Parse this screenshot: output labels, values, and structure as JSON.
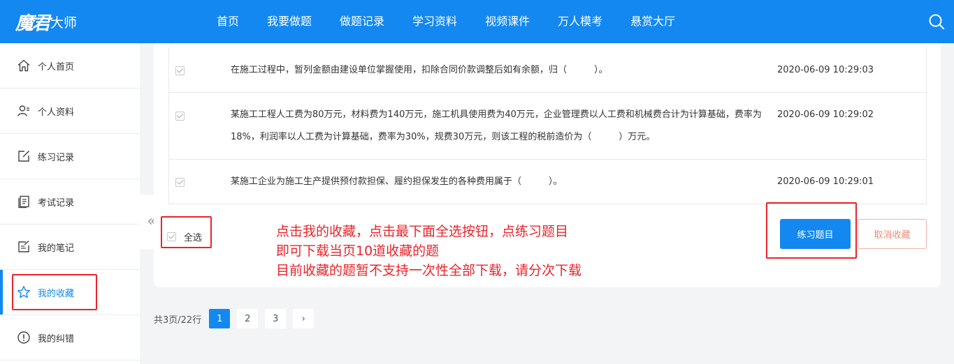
{
  "header": {
    "logo_brush": "魔君",
    "logo_text": "大师",
    "nav": [
      "首页",
      "我要做题",
      "做题记录",
      "学习资料",
      "视频课件",
      "万人模考",
      "悬赏大厅"
    ],
    "search_icon": "search-icon"
  },
  "sidebar": {
    "items": [
      {
        "label": "个人首页",
        "icon": "home-icon"
      },
      {
        "label": "个人资料",
        "icon": "user-profile-icon"
      },
      {
        "label": "练习记录",
        "icon": "edit-square-icon"
      },
      {
        "label": "考试记录",
        "icon": "document-icon"
      },
      {
        "label": "我的笔记",
        "icon": "note-icon"
      },
      {
        "label": "我的收藏",
        "icon": "star-icon",
        "active": true
      },
      {
        "label": "我的纠错",
        "icon": "alert-circle-icon"
      }
    ]
  },
  "collapse": {
    "glyph": "«"
  },
  "questions": [
    {
      "text": "在施工过程中，暂列金额由建设单位掌握使用，扣除合同价款调整后如有余额，归（　　　）。",
      "time": "2020-06-09 10:29:03",
      "checked": true
    },
    {
      "text": "某施工工程人工费为80万元，材料费为140万元，施工机具使用费为40万元，企业管理费以人工费和机械费合计为计算基础，费率为18%，利润率以人工费为计算基础，费率为30%，规费30万元，则该工程的税前造价为（　　　）万元。",
      "time": "2020-06-09 10:29:02",
      "checked": true
    },
    {
      "text": "某施工企业为施工生产提供预付款担保、履约担保发生的各种费用属于（　　　）。",
      "time": "2020-06-09 10:29:01",
      "checked": true
    }
  ],
  "actions": {
    "select_all": "全选",
    "practice": "练习题目",
    "cancel": "取消收藏"
  },
  "annotation": {
    "lines": [
      "点击我的收藏，点击最下面全选按钮，点练习题目",
      "即可下载当页10道收藏的题",
      "目前收藏的题暂不支持一次性全部下载，请分次下载"
    ]
  },
  "pagination": {
    "total": "共3页/22行",
    "pages": [
      "1",
      "2",
      "3"
    ],
    "current": "1",
    "next": "›"
  },
  "colors": {
    "primary": "#1388f0",
    "annotation_red": "#e8242b",
    "cancel": "#f08b77"
  }
}
